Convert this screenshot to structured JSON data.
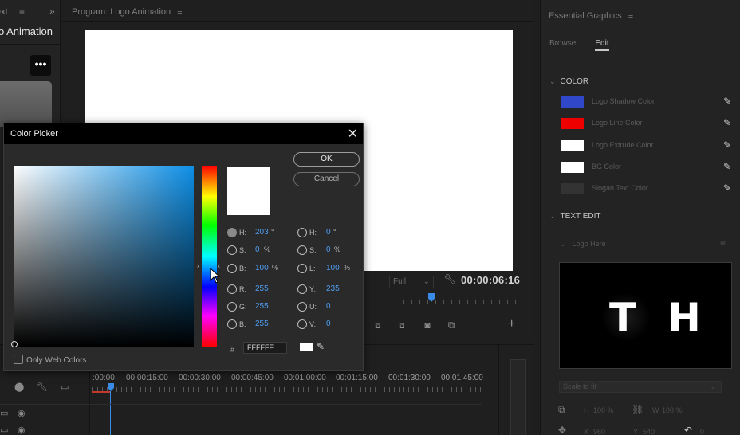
{
  "left_panel": {
    "tab_fragment": "ext",
    "title_fragment": "o Animation"
  },
  "program": {
    "title": "Program: Logo Animation",
    "zoom": "Full",
    "timecode": "00:00:06:16"
  },
  "timeline": {
    "labels": [
      ":00:00",
      "00:00:15:00",
      "00:00:30:00",
      "00:00:45:00",
      "00:01:00:00",
      "00:01:15:00",
      "00:01:30:00",
      "00:01:45:00"
    ]
  },
  "essential_graphics": {
    "title": "Essential Graphics",
    "tab_browse": "Browse",
    "tab_edit": "Edit",
    "color_section": "COLOR",
    "colors": [
      {
        "label": "Logo Shadow Color",
        "color": "#2f47c8"
      },
      {
        "label": "Logo Line Color",
        "color": "#ee0000"
      },
      {
        "label": "Logo Extrude Color",
        "color": "#ffffff"
      },
      {
        "label": "BG Color",
        "color": "#ffffff"
      },
      {
        "label": "Slogan Text Color",
        "color": "#333333"
      }
    ],
    "text_edit_section": "TEXT EDIT",
    "layer_name": "Logo Here",
    "preview_letter_1": "T",
    "preview_letter_2": "H",
    "scale_option": "Scale to fit",
    "height_label": "H",
    "height_value": "100 %",
    "width_label": "W",
    "width_value": "100 %",
    "x_label": "X",
    "x_value": "960",
    "y_label": "Y",
    "y_value": "540",
    "rot_value": "0"
  },
  "color_picker": {
    "title": "Color Picker",
    "ok": "OK",
    "cancel": "Cancel",
    "hsb": {
      "h": "203",
      "h_unit": "°",
      "s": "0",
      "s_unit": "%",
      "b": "100",
      "b_unit": "%"
    },
    "rgb": {
      "r": "255",
      "g": "255",
      "b": "255"
    },
    "hsl": {
      "h": "0",
      "h_unit": "°",
      "s": "0",
      "s_unit": "%",
      "l": "100",
      "l_unit": "%"
    },
    "yuv": {
      "y": "235",
      "u": "0",
      "v": "0"
    },
    "hex_label": "#",
    "hex": "FFFFFF",
    "only_web_colors": "Only Web Colors",
    "hue_fraction": 0.58
  }
}
